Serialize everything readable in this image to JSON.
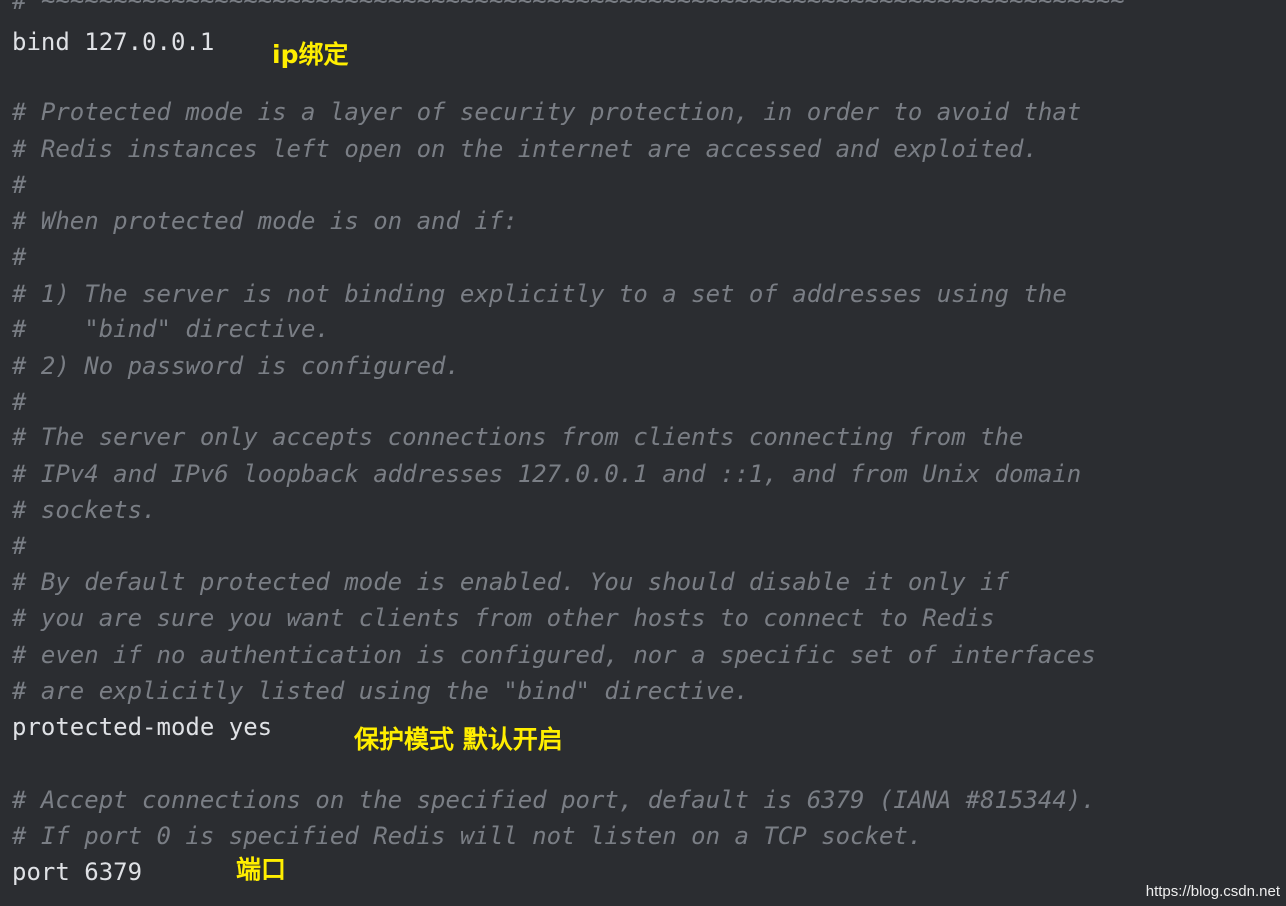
{
  "editor": {
    "lines": [
      "# ~~~~~~~~~~~~~~~~~~~~~~~~~~~~~~~~~~~~~~~~~~~~~~~~~~~~~~~~~~~~~~~~~~~~~~~~~~~",
      "bind 127.0.0.1",
      "# Protected mode is a layer of security protection, in order to avoid that",
      "# Redis instances left open on the internet are accessed and exploited.",
      "#",
      "# When protected mode is on and if:",
      "#",
      "# 1) The server is not binding explicitly to a set of addresses using the",
      "#    \"bind\" directive.",
      "# 2) No password is configured.",
      "#",
      "# The server only accepts connections from clients connecting from the",
      "# IPv4 and IPv6 loopback addresses 127.0.0.1 and ::1, and from Unix domain",
      "# sockets.",
      "#",
      "# By default protected mode is enabled. You should disable it only if",
      "# you are sure you want clients from other hosts to connect to Redis",
      "# even if no authentication is configured, nor a specific set of interfaces",
      "# are explicitly listed using the \"bind\" directive.",
      "protected-mode yes",
      "# Accept connections on the specified port, default is 6379 (IANA #815344).",
      "# If port 0 is specified Redis will not listen on a TCP socket.",
      "port 6379"
    ]
  },
  "annotations": {
    "bind": "ip绑定",
    "protected_mode": "保护模式 默认开启",
    "port": "端口"
  },
  "watermark": "https://blog.csdn.net"
}
